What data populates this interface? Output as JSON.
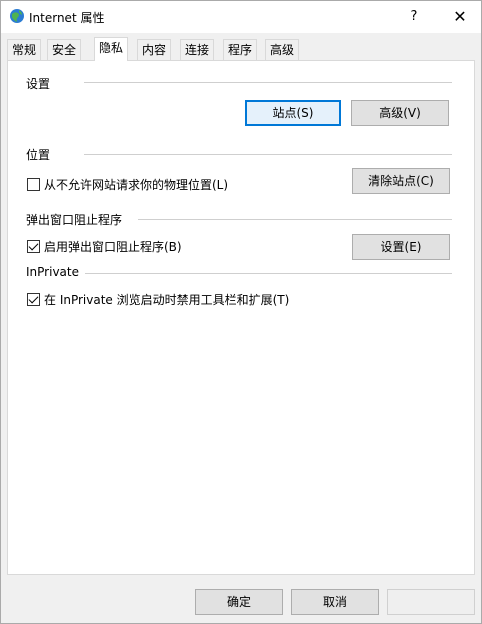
{
  "window": {
    "title": "Internet 属性",
    "help": "?",
    "close": "✕"
  },
  "tabs": [
    {
      "label": "常规",
      "active": false
    },
    {
      "label": "安全",
      "active": false
    },
    {
      "label": "隐私",
      "active": true
    },
    {
      "label": "内容",
      "active": false
    },
    {
      "label": "连接",
      "active": false
    },
    {
      "label": "程序",
      "active": false
    },
    {
      "label": "高级",
      "active": false
    }
  ],
  "settings": {
    "group_label": "设置",
    "sites_button": "站点(S)",
    "advanced_button": "高级(V)"
  },
  "location": {
    "group_label": "位置",
    "never_allow_label": "从不允许网站请求你的物理位置(L)",
    "never_allow_checked": false,
    "clear_sites_button": "清除站点(C)"
  },
  "popup": {
    "group_label": "弹出窗口阻止程序",
    "enable_label": "启用弹出窗口阻止程序(B)",
    "enable_checked": true,
    "settings_button": "设置(E)"
  },
  "inprivate": {
    "group_label": "InPrivate",
    "disable_toolbars_label": "在 InPrivate 浏览启动时禁用工具栏和扩展(T)",
    "disable_toolbars_checked": true
  },
  "footer": {
    "ok": "确定",
    "cancel": "取消",
    "apply": ""
  },
  "colors": {
    "focus_border": "#0078d7",
    "panel_bg": "#ffffff",
    "window_bg": "#f0f0f0"
  }
}
